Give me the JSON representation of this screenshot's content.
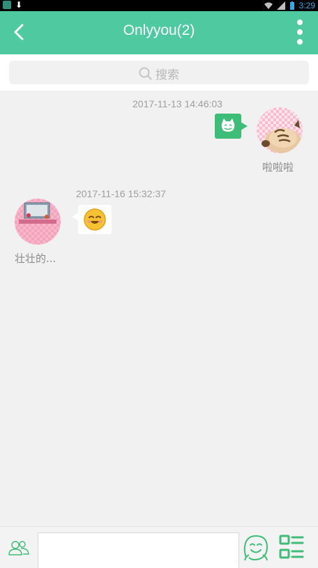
{
  "status_bar": {
    "time": "3:29",
    "icons": [
      "app-icon",
      "download-icon",
      "wifi-icon",
      "signal-icon",
      "battery-icon"
    ]
  },
  "header": {
    "title": "Onlyyou(2)",
    "back_icon": "chevron-left-icon",
    "more_icon": "more-vert-icon",
    "color": "#4ec9a0"
  },
  "search": {
    "placeholder": "搜索",
    "icon": "search-icon"
  },
  "messages": [
    {
      "timestamp": "2017-11-13 14:46:03",
      "sender": "啦啦啦",
      "side": "right",
      "content_icon": "cat-sticker-icon",
      "bubble_color": "#3dbd78"
    },
    {
      "timestamp": "2017-11-16 15:32:37",
      "sender": "壮壮的...",
      "side": "left",
      "content_icon": "smiling-face-emoji",
      "bubble_color": "#ffffff"
    }
  ],
  "input_bar": {
    "group_icon": "group-members-icon",
    "text_value": "",
    "emoji_icon": "emoji-face-icon",
    "menu_icon": "grid-list-icon",
    "accent": "#3dbd78"
  }
}
